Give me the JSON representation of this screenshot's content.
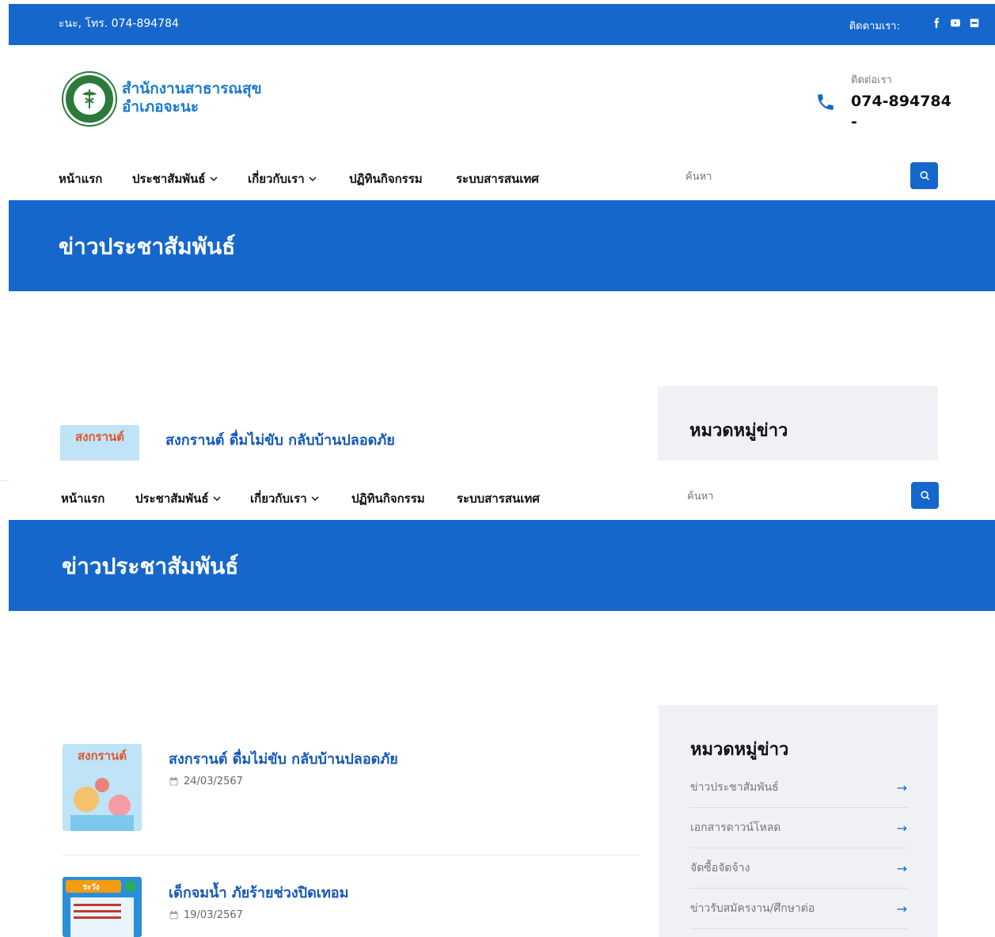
{
  "topbar": {
    "contact": "ะนะ, โทร. 074-894784",
    "follow_label": "ติดตามเรา:",
    "social": [
      "facebook-icon",
      "youtube-icon",
      "line-icon"
    ]
  },
  "header": {
    "logo_line1": "สำนักงานสาธารณสุข",
    "logo_line2": "อำเภอจะนะ",
    "call_label": "ติดต่อเรา",
    "call_number": "074-894784",
    "call_suffix": "-"
  },
  "nav": {
    "items": [
      {
        "label": "หน้าแรก",
        "dropdown": false
      },
      {
        "label": "ประชาสัมพันธ์",
        "dropdown": true
      },
      {
        "label": "เกี่ยวกับเรา",
        "dropdown": true
      },
      {
        "label": "ปฏิทินกิจกรรม",
        "dropdown": false
      },
      {
        "label": "ระบบสารสนเทศ",
        "dropdown": false
      }
    ],
    "search_placeholder": "ค้นหา"
  },
  "banner": {
    "title": "ข่าวประชาสัมพันธ์"
  },
  "sidebar": {
    "title": "หมวดหมู่ข่าว",
    "categories": [
      {
        "label": "ข่าวประชาสัมพันธ์",
        "arrow": "→"
      },
      {
        "label": "เอกสารดาวน์โหลด",
        "arrow": "→"
      },
      {
        "label": "จัดซื้อจัดจ้าง",
        "arrow": "→"
      },
      {
        "label": "ข่าวรับสมัครงาน/ศึกษาต่อ",
        "arrow": "→"
      }
    ]
  },
  "news": [
    {
      "title": "สงกรานต์ ดื่มไม่ขับ กลับบ้านปลอดภัย",
      "date": "24/03/2567",
      "thumb_text": "สงกรานต์"
    },
    {
      "title": "เด็กจมน้ำ ภัยร้ายช่วงปิดเทอม",
      "date": "19/03/2567",
      "thumb_text": "ระวัง"
    }
  ]
}
